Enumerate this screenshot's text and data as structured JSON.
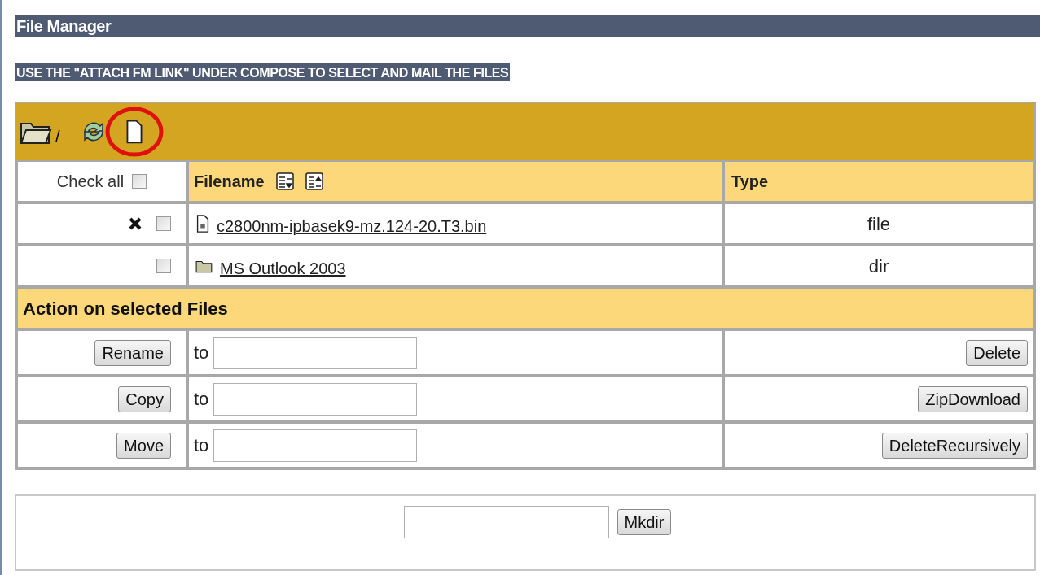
{
  "title": "File Manager",
  "notice": "USE THE \"ATTACH FM LINK\" UNDER COMPOSE TO SELECT AND MAIL THE FILES",
  "toolbar": {
    "path": "/",
    "highlight_new_file": true
  },
  "header": {
    "check_all": "Check all",
    "check_all_checked": false,
    "filename": "Filename",
    "type": "Type"
  },
  "rows": [
    {
      "name": "c2800nm-ipbasek9-mz.124-20.T3.bin",
      "kind": "file",
      "type": "file",
      "checked": false,
      "deletable": true
    },
    {
      "name": "MS Outlook 2003",
      "kind": "dir",
      "type": "dir",
      "checked": false,
      "deletable": false
    }
  ],
  "actions_title": "Action on selected Files",
  "actions": [
    {
      "button": "Rename",
      "to": "to",
      "right_button": "Delete"
    },
    {
      "button": "Copy",
      "to": "to",
      "right_button": "ZipDownload"
    },
    {
      "button": "Move",
      "to": "to",
      "right_button": "DeleteRecursively"
    }
  ],
  "mkdir": {
    "button": "Mkdir"
  }
}
